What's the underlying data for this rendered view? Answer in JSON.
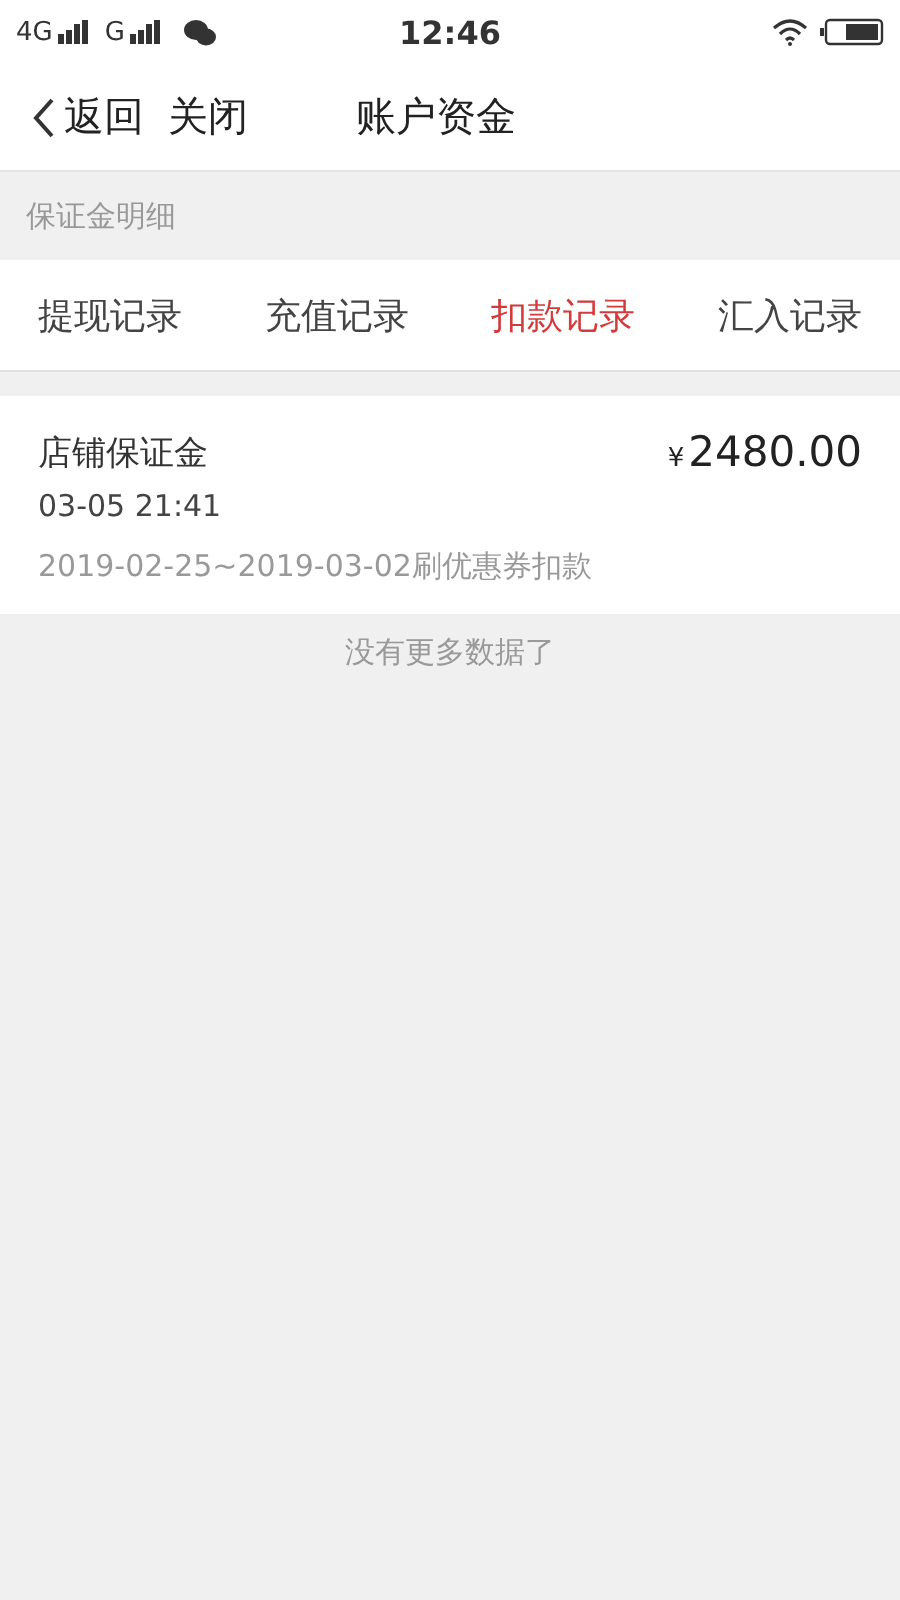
{
  "status_bar": {
    "network_1": "4G",
    "network_2": "G",
    "time": "12:46"
  },
  "nav": {
    "back": "返回",
    "close": "关闭",
    "title": "账户资金"
  },
  "section_title": "保证金明细",
  "tabs": [
    {
      "label": "提现记录",
      "selected": false
    },
    {
      "label": "充值记录",
      "selected": false
    },
    {
      "label": "扣款记录",
      "selected": true
    },
    {
      "label": "汇入记录",
      "selected": false
    }
  ],
  "records": [
    {
      "name": "店铺保证金",
      "currency": "¥",
      "amount": "2480.00",
      "time": "03-05 21:41",
      "note": "2019-02-25~2019-03-02刷优惠券扣款"
    }
  ],
  "footer": "没有更多数据了"
}
